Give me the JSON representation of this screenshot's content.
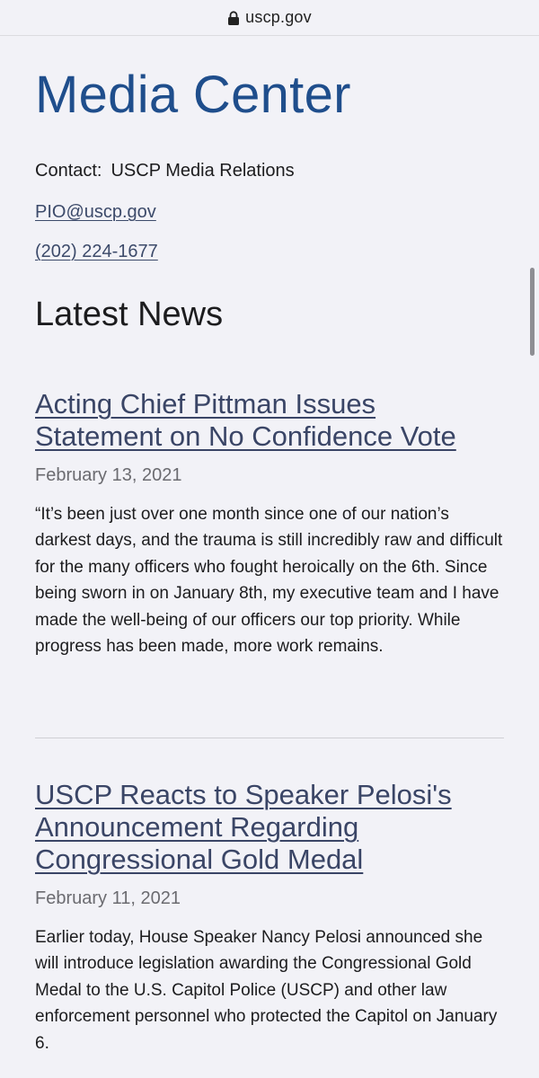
{
  "browser": {
    "url": "uscp.gov",
    "icons": {
      "lock": "lock-icon"
    }
  },
  "page": {
    "title": "Media Center",
    "contact": {
      "label": "Contact:",
      "name": "USCP Media Relations",
      "email": "PIO@uscp.gov",
      "phone": "(202) 224-1677"
    },
    "section_title": "Latest News",
    "articles": [
      {
        "title": "Acting Chief Pittman Issues Statement on No Confidence Vote",
        "date": "February 13, 2021",
        "summary": "“It’s been just over one month since one of our nation’s darkest days, and the trauma is still incredibly raw and difficult for the many officers who fought heroically on the 6th. Since being sworn in on January 8th, my executive team and I have made the well-being of our officers our top priority. While progress has been made, more work remains."
      },
      {
        "title": "USCP Reacts to Speaker Pelosi's Announcement Regarding Congressional Gold Medal",
        "date": "February 11, 2021",
        "summary": "Earlier today, House Speaker Nancy Pelosi announced she will introduce legislation awarding the Congressional Gold Medal to the U.S. Capitol Police (USCP) and other law enforcement personnel who protected the Capitol on January 6."
      }
    ]
  },
  "colors": {
    "title": "#1f4e8c",
    "link": "#3c4a6a",
    "background": "#f2f2f7",
    "date": "#6b6b70"
  }
}
